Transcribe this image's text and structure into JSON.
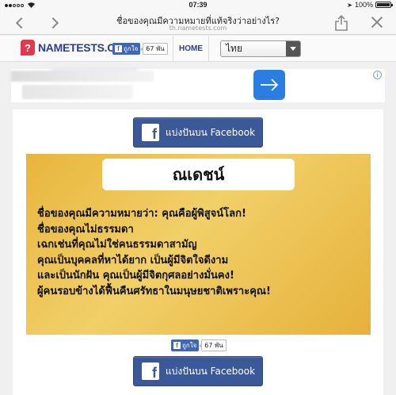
{
  "status_bar": {
    "carrier": "ooo",
    "time": "07:39",
    "battery": "100%"
  },
  "browser": {
    "page_title": "ชื่อของคุณมีความหมายที่แท้จริงว่าอย่างไร?",
    "url": "th.nametests.com"
  },
  "site_header": {
    "logo_letter": "?",
    "logo_text": "NAMETESTS.COM",
    "like_label": "ถูกใจ",
    "like_count": "67 พัน",
    "home_label": "HOME",
    "language_selected": "ไทย"
  },
  "ad": {
    "choice_label": "i"
  },
  "card": {
    "share_label": "แบ่งปันบน Facebook",
    "result_name": "ณเดชน์",
    "result_lines": [
      "ชื่อของคุณมีความหมายว่า: คุณคือผู้พิสูจน์โลก!",
      "ชื่อของคุณไม่ธรรมดา",
      "เฉกเช่นที่คุณไม่ใช่คนธรรมดาสามัญ",
      "คุณเป็นบุคคลที่หาได้ยาก เป็นผู้มีจิตใจดีงาม",
      "และเป็นนักฝัน คุณเป็นผู้มีจิตกุศลอย่างมั่นคง!",
      "ผู้คนรอบข้างได้ฟื้นคืนศรัทธาในมนุษยชาติเพราะคุณ!"
    ],
    "like_label": "ถูกใจ",
    "like_count": "67 พัน",
    "share_label_bottom": "แบ่งปันบน Facebook"
  },
  "colors": {
    "facebook_blue": "#3b5998",
    "brand_navy": "#2f3d8f",
    "logo_red": "#e2384d",
    "result_gold": "#e8b53c",
    "ad_blue": "#2a7de1"
  }
}
